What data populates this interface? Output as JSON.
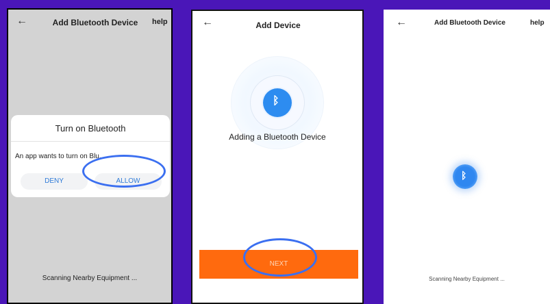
{
  "panel1": {
    "title": "Add Bluetooth Device",
    "help": "help",
    "dialog": {
      "title": "Turn on Bluetooth",
      "message": "An app wants to turn on Blu...",
      "deny_label": "DENY",
      "allow_label": "ALLOW"
    },
    "scan_text": "Scanning Nearby Equipment ..."
  },
  "panel2": {
    "title": "Add Device",
    "adding_text": "Adding a Bluetooth Device",
    "next_label": "NEXT"
  },
  "panel3": {
    "title": "Add Bluetooth Device",
    "help": "help",
    "scan_text": "Scanning Nearby Equipment ..."
  },
  "icons": {
    "back": "←",
    "bluetooth": "ᛒ"
  },
  "colors": {
    "background": "#4a16b8",
    "accent": "#ff6a0e",
    "bluetooth": "#2d8cf0",
    "highlight": "#3b6ff0"
  }
}
